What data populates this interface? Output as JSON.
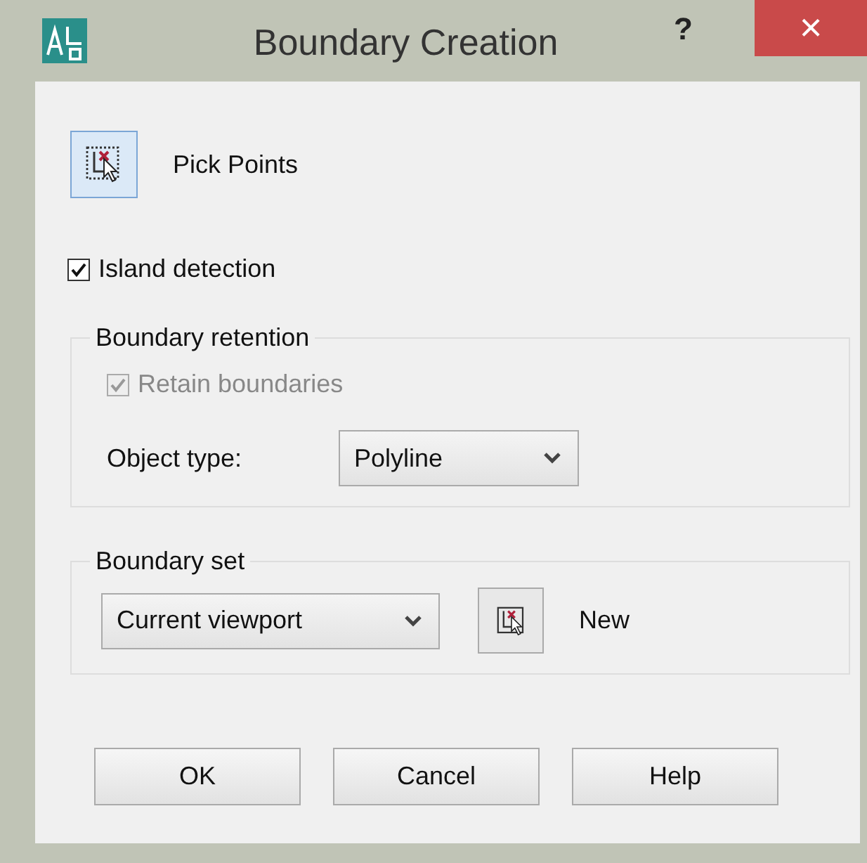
{
  "window": {
    "title": "Boundary Creation",
    "help": "?",
    "close": "×"
  },
  "pick_points": {
    "label": "Pick Points"
  },
  "island_detection": {
    "label": "Island detection",
    "checked": true
  },
  "boundary_retention": {
    "title": "Boundary retention",
    "retain": {
      "label": "Retain boundaries",
      "checked": true,
      "disabled": true
    },
    "object_type": {
      "label": "Object type:",
      "value": "Polyline"
    }
  },
  "boundary_set": {
    "title": "Boundary set",
    "value": "Current viewport",
    "new_label": "New"
  },
  "buttons": [
    "OK",
    "Cancel",
    "Help"
  ]
}
